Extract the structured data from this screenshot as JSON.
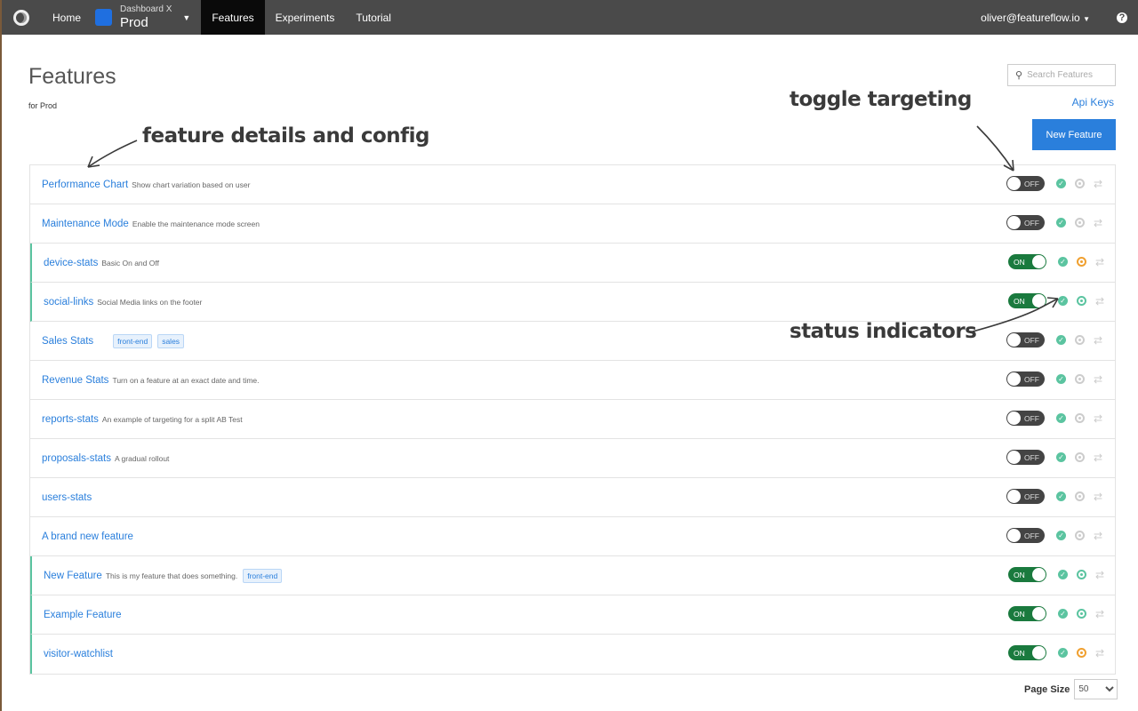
{
  "nav": {
    "home": "Home",
    "env_label": "Dashboard X",
    "env_name": "Prod",
    "features": "Features",
    "experiments": "Experiments",
    "tutorial": "Tutorial",
    "user": "oliver@featureflow.io",
    "help": "?"
  },
  "page": {
    "title": "Features",
    "subtitle": "for Prod",
    "search_placeholder": "Search Features",
    "api_keys": "Api Keys",
    "new_feature": "New Feature",
    "page_size_label": "Page Size",
    "page_size": "50"
  },
  "annotations": {
    "details": "feature details and config",
    "toggle": "toggle targeting",
    "status": "status indicators"
  },
  "colors": {
    "accent": "#2a7fdc",
    "on": "#1a7a3e",
    "ok": "#5bc4a0",
    "warn": "#f0a030",
    "idle": "#cccccc"
  },
  "features": [
    {
      "name": "Performance Chart",
      "desc": "Show chart variation based on user",
      "tags": [],
      "toggle": "OFF",
      "status": "idle"
    },
    {
      "name": "Maintenance Mode",
      "desc": "Enable the maintenance mode screen",
      "tags": [],
      "toggle": "OFF",
      "status": "idle"
    },
    {
      "name": "device-stats",
      "desc": "Basic On and Off",
      "tags": [],
      "toggle": "ON",
      "status": "warn"
    },
    {
      "name": "social-links",
      "desc": "Social Media links on the footer",
      "tags": [],
      "toggle": "ON",
      "status": "ok"
    },
    {
      "name": "Sales Stats",
      "desc": "",
      "tags": [
        "front-end",
        "sales"
      ],
      "toggle": "OFF",
      "status": "idle"
    },
    {
      "name": "Revenue Stats",
      "desc": "Turn on a feature at an exact date and time.",
      "tags": [],
      "toggle": "OFF",
      "status": "idle"
    },
    {
      "name": "reports-stats",
      "desc": "An example of targeting for a split AB Test",
      "tags": [],
      "toggle": "OFF",
      "status": "idle"
    },
    {
      "name": "proposals-stats",
      "desc": "A gradual rollout",
      "tags": [],
      "toggle": "OFF",
      "status": "idle"
    },
    {
      "name": "users-stats",
      "desc": "",
      "tags": [],
      "toggle": "OFF",
      "status": "idle"
    },
    {
      "name": "A brand new feature",
      "desc": "",
      "tags": [],
      "toggle": "OFF",
      "status": "idle"
    },
    {
      "name": "New Feature",
      "desc": "This is my feature that does something.",
      "tags": [
        "front-end"
      ],
      "toggle": "ON",
      "status": "ok"
    },
    {
      "name": "Example Feature",
      "desc": "",
      "tags": [],
      "toggle": "ON",
      "status": "ok"
    },
    {
      "name": "visitor-watchlist",
      "desc": "",
      "tags": [],
      "toggle": "ON",
      "status": "warn"
    }
  ]
}
